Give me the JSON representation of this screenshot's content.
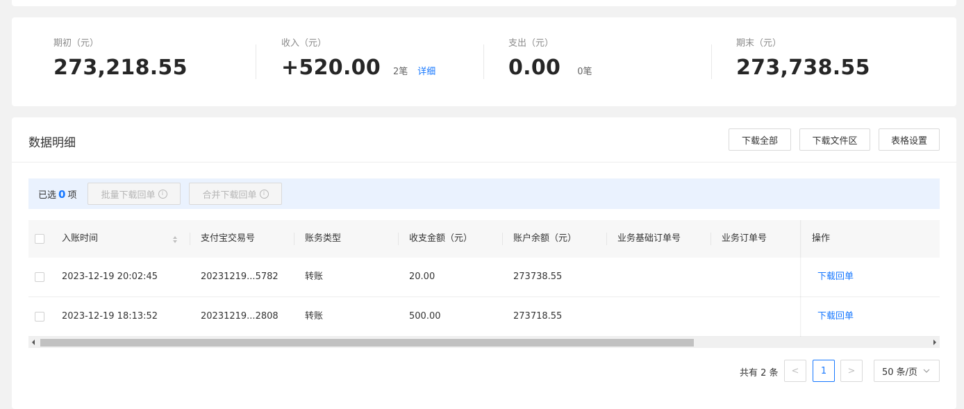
{
  "summary": {
    "opening": {
      "label": "期初（元）",
      "value": "273,218.55"
    },
    "income": {
      "label": "收入（元）",
      "value": "+520.00",
      "count": "2笔",
      "link": "详细"
    },
    "expense": {
      "label": "支出（元）",
      "value": "0.00",
      "count": "0笔"
    },
    "closing": {
      "label": "期末（元）",
      "value": "273,738.55"
    }
  },
  "details": {
    "title": "数据明细",
    "buttons": {
      "download_all": "下载全部",
      "download_area": "下载文件区",
      "table_settings": "表格设置"
    },
    "selection": {
      "prefix": "已选",
      "count": "0",
      "suffix": "项",
      "batch_download": "批量下载回单",
      "merge_download": "合并下载回单",
      "info_glyph": "i"
    },
    "columns": [
      "入账时间",
      "支付宝交易号",
      "账务类型",
      "收支金额（元）",
      "账户余额（元）",
      "业务基础订单号",
      "业务订单号",
      "操作"
    ],
    "rows": [
      {
        "time": "2023-12-19 20:02:45",
        "trade_no": "20231219...5782",
        "type": "转账",
        "amount": "20.00",
        "balance": "273738.55",
        "base_order": "",
        "order": "",
        "action": "下载回单"
      },
      {
        "time": "2023-12-19 18:13:52",
        "trade_no": "20231219...2808",
        "type": "转账",
        "amount": "500.00",
        "balance": "273718.55",
        "base_order": "",
        "order": "",
        "action": "下载回单"
      }
    ],
    "pagination": {
      "total_text": "共有 2 条",
      "prev": "<",
      "page": "1",
      "next": ">",
      "page_size": "50 条/页",
      "dropdown_icon": "chevron-down-icon"
    }
  },
  "colors": {
    "accent": "#1677ff",
    "selection_bg": "#eaf2fe",
    "page_bg": "#f2f2f2"
  }
}
